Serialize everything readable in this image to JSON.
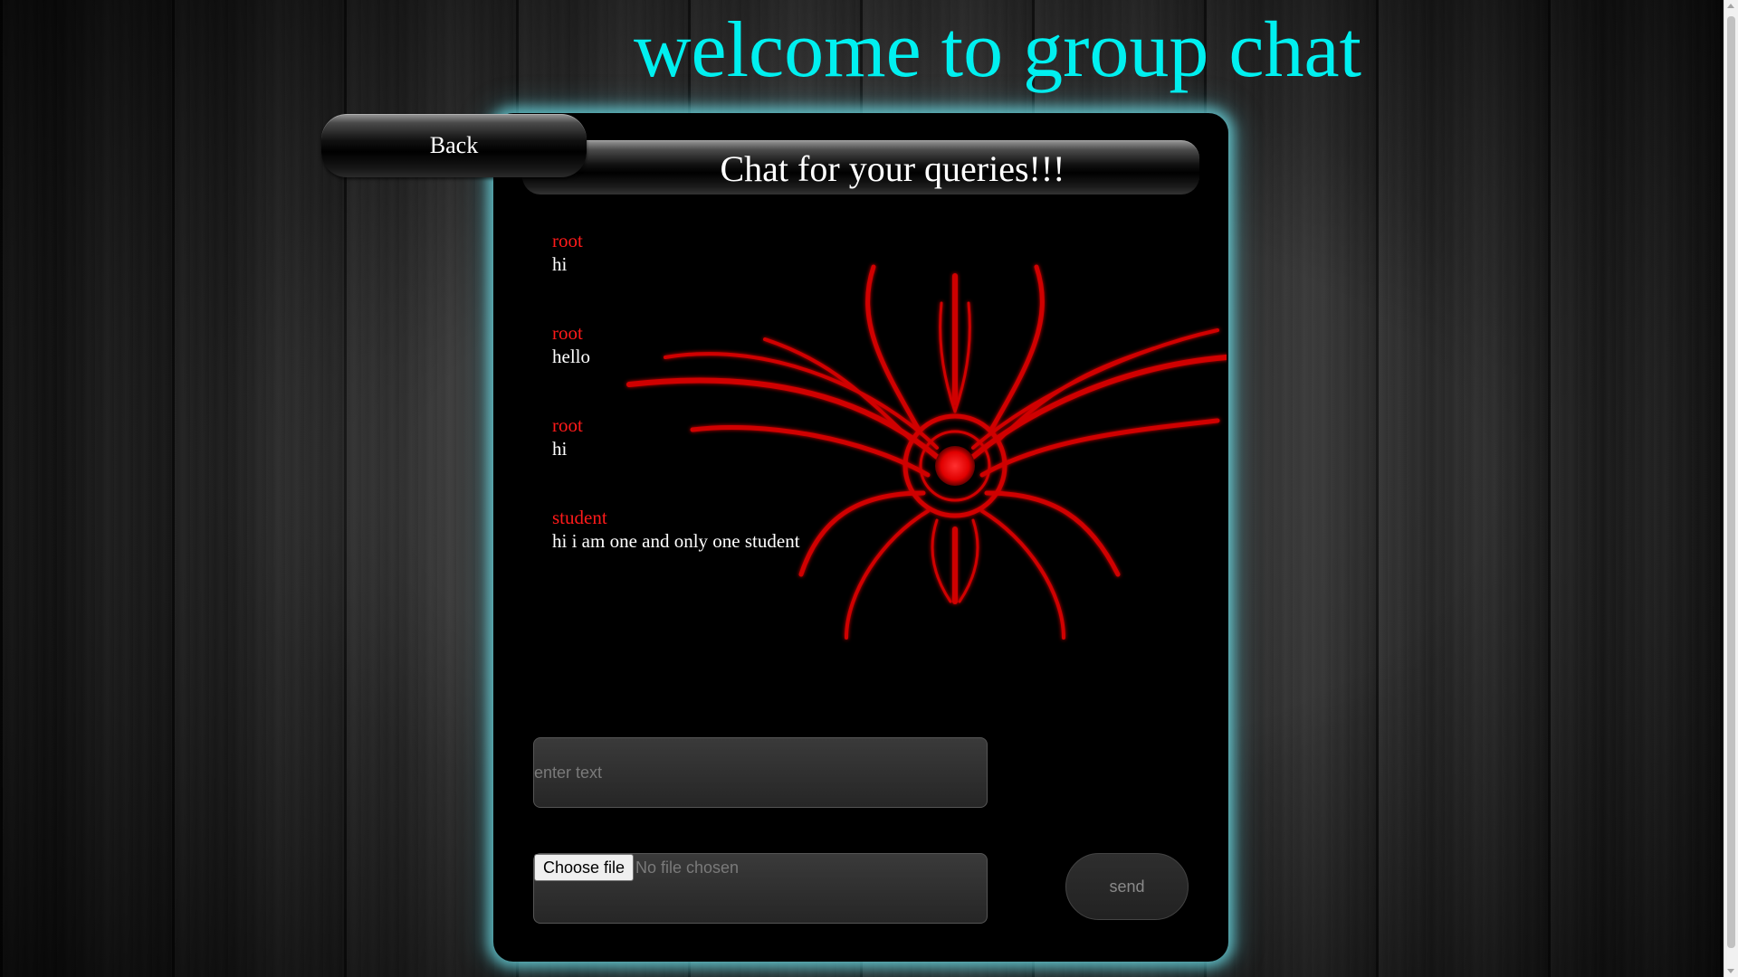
{
  "page": {
    "title": "welcome to group chat",
    "accent_color": "#00f0f0",
    "username_color": "#ff1a1a"
  },
  "nav": {
    "back_label": "Back"
  },
  "chat": {
    "header_title": "Chat for your queries!!!",
    "messages": [
      {
        "user": "root",
        "text": "hi"
      },
      {
        "user": "root",
        "text": "hello"
      },
      {
        "user": "root",
        "text": "hi"
      },
      {
        "user": "student",
        "text": "hi i am one and only one student"
      }
    ]
  },
  "composer": {
    "text_placeholder": "enter text",
    "text_value": "",
    "file_button_label": "Choose file",
    "file_status": "No file chosen",
    "send_label": "send"
  },
  "icons": {
    "emblem": "red-tribal-emblem"
  }
}
